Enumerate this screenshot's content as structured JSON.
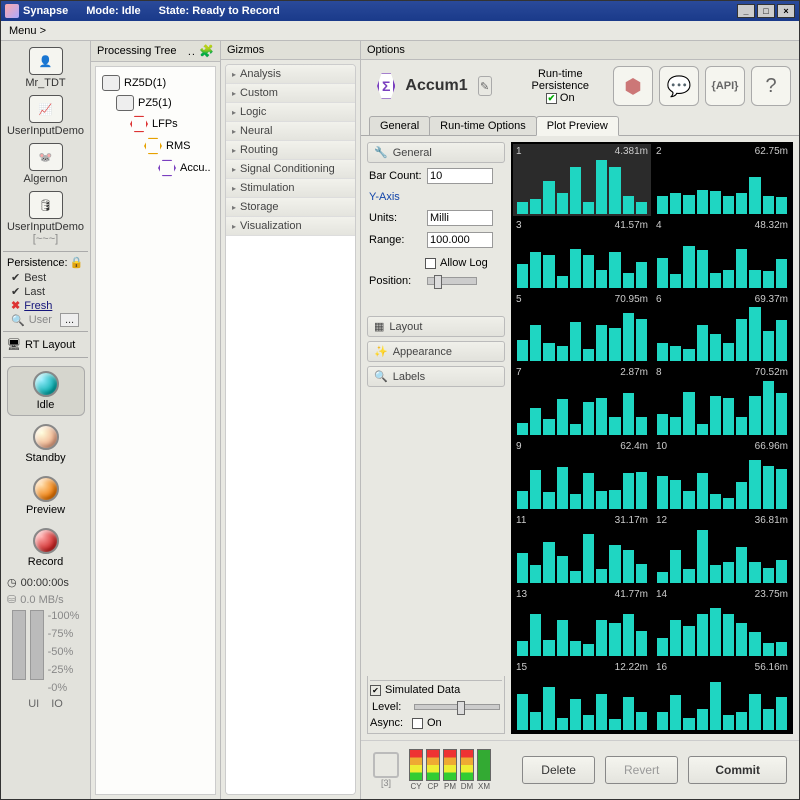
{
  "titlebar": {
    "app": "Synapse",
    "mode": "Mode: Idle",
    "state": "State: Ready to Record"
  },
  "menubar": {
    "menu": "Menu >"
  },
  "rail": {
    "items": [
      {
        "label": "Mr_TDT"
      },
      {
        "label": "UserInputDemo"
      },
      {
        "label": "Algernon"
      },
      {
        "label": "UserInputDemo"
      },
      {
        "sublabel": "[~~~]"
      }
    ],
    "persistence_label": "Persistence:",
    "persist": {
      "best": "Best",
      "last": "Last",
      "fresh": "Fresh",
      "user": "User",
      "dots": "..."
    },
    "rt_layout": "RT Layout",
    "modes": {
      "idle": "Idle",
      "standby": "Standby",
      "preview": "Preview",
      "record": "Record"
    },
    "timer": "00:00:00s",
    "disk": "0.0 MB/s",
    "scale": [
      "-100%",
      "-75%",
      "-50%",
      "-25%",
      "-0%"
    ],
    "ui": "UI",
    "io": "IO"
  },
  "tree": {
    "title": "Processing Tree",
    "nodes": [
      {
        "label": "RZ5D(1)",
        "indent": 0,
        "kind": "device"
      },
      {
        "label": "PZ5(1)",
        "indent": 1,
        "kind": "device"
      },
      {
        "label": "LFPs",
        "indent": 2,
        "kind": "hex",
        "color": "#d33"
      },
      {
        "label": "RMS",
        "indent": 3,
        "kind": "hex",
        "color": "#e6a100"
      },
      {
        "label": "Accu..",
        "indent": 4,
        "kind": "hex",
        "color": "#7a3fbf"
      }
    ]
  },
  "gizmos": {
    "title": "Gizmos",
    "cats": [
      "Analysis",
      "Custom",
      "Logic",
      "Neural",
      "Routing",
      "Signal Conditioning",
      "Stimulation",
      "Storage",
      "Visualization"
    ]
  },
  "options": {
    "title": "Options",
    "name": "Accum1",
    "runtime_persist_label": "Run-time\nPersistence",
    "runtime_persist_on": "On",
    "tabs": [
      "General",
      "Run-time Options",
      "Plot Preview"
    ],
    "active_tab": 2,
    "sections": {
      "general": "General",
      "layout": "Layout",
      "appearance": "Appearance",
      "labels": "Labels"
    },
    "fields": {
      "bar_count_label": "Bar Count:",
      "bar_count": "10",
      "yaxis": "Y-Axis",
      "units_label": "Units:",
      "units": "Milli",
      "range_label": "Range:",
      "range": "100.000",
      "allow_log": "Allow Log",
      "position_label": "Position:"
    },
    "sim": {
      "title": "Simulated Data",
      "level": "Level:",
      "async": "Async:",
      "on": "On"
    },
    "bottom": {
      "delete": "Delete",
      "revert": "Revert",
      "commit": "Commit",
      "chip_sub": "[3]",
      "leds": [
        "CY",
        "CP",
        "PM",
        "DM",
        "XM"
      ]
    }
  },
  "chart_data": {
    "type": "bar",
    "grid": "2x8",
    "bar_count": 10,
    "y_units": "Milli",
    "y_range": 100.0,
    "selected": 1,
    "plots": [
      {
        "n": 1,
        "value": "4.381m",
        "bars": [
          20,
          25,
          55,
          35,
          78,
          20,
          90,
          78,
          30,
          20
        ]
      },
      {
        "n": 2,
        "value": "62.75m",
        "bars": [
          30,
          35,
          32,
          40,
          38,
          30,
          35,
          62,
          30,
          28
        ]
      },
      {
        "n": 3,
        "value": "41.57m",
        "bars": [
          40,
          60,
          55,
          20,
          65,
          55,
          30,
          60,
          25,
          42
        ]
      },
      {
        "n": 4,
        "value": "48.32m",
        "bars": [
          50,
          22,
          70,
          62,
          25,
          30,
          65,
          30,
          28,
          48
        ]
      },
      {
        "n": 5,
        "value": "70.95m",
        "bars": [
          35,
          60,
          30,
          25,
          65,
          20,
          60,
          55,
          80,
          71
        ]
      },
      {
        "n": 6,
        "value": "69.37m",
        "bars": [
          30,
          25,
          20,
          60,
          45,
          30,
          70,
          90,
          50,
          69
        ]
      },
      {
        "n": 7,
        "value": "2.87m",
        "bars": [
          20,
          45,
          26,
          60,
          18,
          55,
          62,
          30,
          70,
          30
        ]
      },
      {
        "n": 8,
        "value": "70.52m",
        "bars": [
          35,
          30,
          72,
          18,
          65,
          62,
          30,
          65,
          90,
          71
        ]
      },
      {
        "n": 9,
        "value": "62.4m",
        "bars": [
          30,
          65,
          28,
          70,
          25,
          60,
          30,
          32,
          60,
          62
        ]
      },
      {
        "n": 10,
        "value": "66.96m",
        "bars": [
          55,
          48,
          30,
          60,
          25,
          18,
          45,
          82,
          72,
          67
        ]
      },
      {
        "n": 11,
        "value": "31.17m",
        "bars": [
          50,
          30,
          68,
          45,
          20,
          82,
          22,
          62,
          55,
          31
        ]
      },
      {
        "n": 12,
        "value": "36.81m",
        "bars": [
          18,
          55,
          22,
          88,
          30,
          35,
          60,
          35,
          25,
          37
        ]
      },
      {
        "n": 13,
        "value": "41.77m",
        "bars": [
          25,
          70,
          28,
          60,
          25,
          20,
          60,
          55,
          70,
          42
        ]
      },
      {
        "n": 14,
        "value": "23.75m",
        "bars": [
          30,
          60,
          50,
          70,
          80,
          70,
          55,
          40,
          22,
          24
        ]
      },
      {
        "n": 15,
        "value": "12.22m",
        "bars": [
          60,
          30,
          72,
          20,
          52,
          25,
          60,
          18,
          55,
          30
        ]
      },
      {
        "n": 16,
        "value": "56.16m",
        "bars": [
          30,
          58,
          20,
          35,
          80,
          25,
          30,
          60,
          35,
          56
        ]
      }
    ]
  }
}
